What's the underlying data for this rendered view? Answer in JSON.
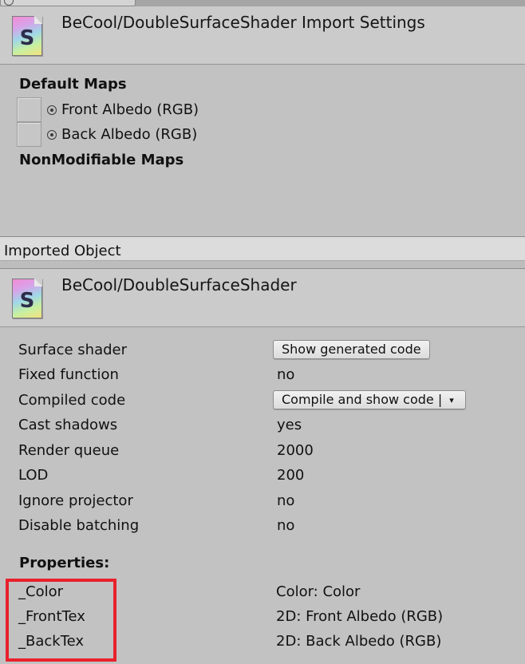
{
  "import_settings": {
    "title": "BeCool/DoubleSurfaceShader Import Settings",
    "icon_letter": "S",
    "default_maps_heading": "Default Maps",
    "default_maps": [
      {
        "label": "Front Albedo (RGB)"
      },
      {
        "label": "Back Albedo (RGB)"
      }
    ],
    "nonmodifiable_heading": "NonModifiable Maps"
  },
  "imported_object": {
    "section_label": "Imported Object",
    "title": "BeCool/DoubleSurfaceShader",
    "icon_letter": "S"
  },
  "info": {
    "surface_shader": {
      "label": "Surface shader",
      "button": "Show generated code"
    },
    "fixed_function": {
      "label": "Fixed function",
      "value": "no"
    },
    "compiled_code": {
      "label": "Compiled code",
      "button": "Compile and show code",
      "caret": "▾"
    },
    "cast_shadows": {
      "label": "Cast shadows",
      "value": "yes"
    },
    "render_queue": {
      "label": "Render queue",
      "value": "2000"
    },
    "lod": {
      "label": "LOD",
      "value": "200"
    },
    "ignore_projector": {
      "label": "Ignore projector",
      "value": "no"
    },
    "disable_batching": {
      "label": "Disable batching",
      "value": "no"
    }
  },
  "properties": {
    "heading": "Properties:",
    "items": [
      {
        "name": "_Color",
        "value": "Color: Color"
      },
      {
        "name": "_FrontTex",
        "value": "2D: Front Albedo (RGB)"
      },
      {
        "name": "_BackTex",
        "value": "2D: Back Albedo (RGB)"
      }
    ]
  },
  "colors": {
    "panel_bg": "#c2c2c2",
    "header_bg": "#cbcbcb",
    "highlight": "#e8212c"
  }
}
